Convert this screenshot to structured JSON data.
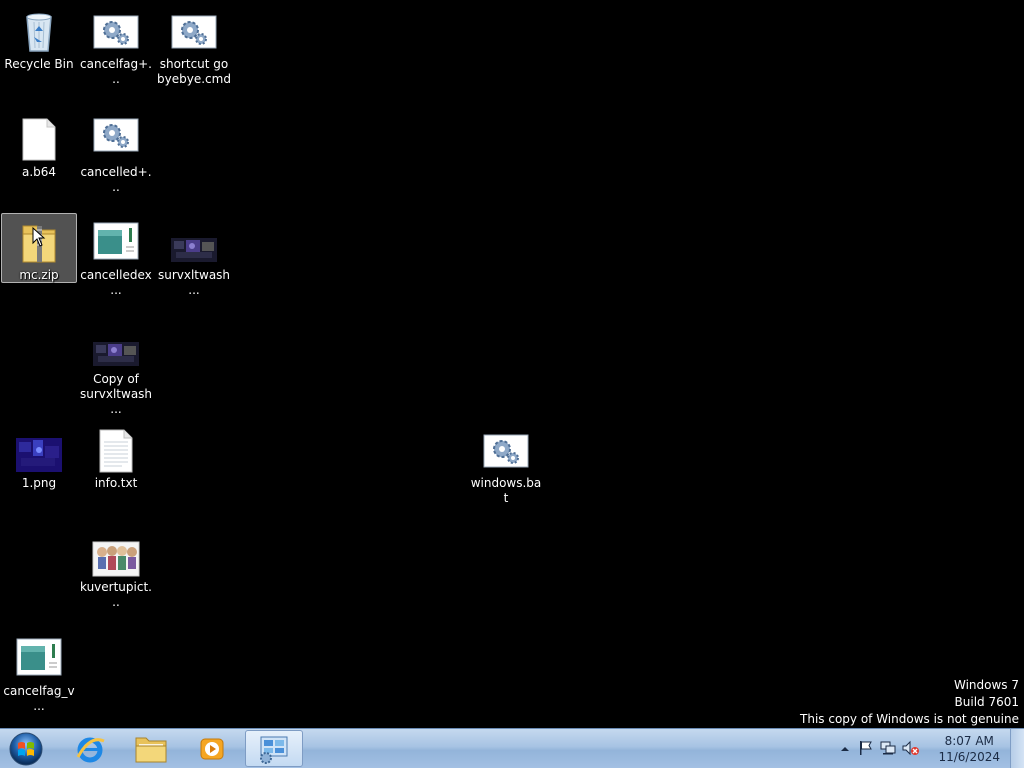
{
  "desktop": {
    "icons": {
      "recycle_bin": "Recycle Bin",
      "cancelfag_plus": "cancelfag+...",
      "shortcut_go": "shortcut go byebye.cmd",
      "a_b64": "a.b64",
      "cancelled_plus": "cancelled+...",
      "mc_zip": "mc.zip",
      "cancelledex": "cancelledex...",
      "survxltwash": "survxltwash...",
      "copy_of_survxltwash": "Copy of survxltwash...",
      "png_1": "1.png",
      "info_txt": "info.txt",
      "windows_bat": "windows.bat",
      "kuvertupict": "kuvertupict...",
      "cancelfag_v": "cancelfag_v..."
    },
    "selected_icon": "mc.zip"
  },
  "watermark": {
    "line1": "Windows 7",
    "line2": "Build 7601",
    "line3": "This copy of Windows is not genuine"
  },
  "taskbar": {
    "pinned": [
      "start-orb",
      "internet-explorer",
      "windows-explorer",
      "windows-media-player",
      "control-panel"
    ],
    "active": "control-panel"
  },
  "clock": {
    "time": "8:07 AM",
    "date": "11/6/2024"
  },
  "colors": {
    "desktop_background": "#000000",
    "taskbar_top": "#c5d9ef",
    "taskbar_bottom": "#a3c0e3"
  }
}
